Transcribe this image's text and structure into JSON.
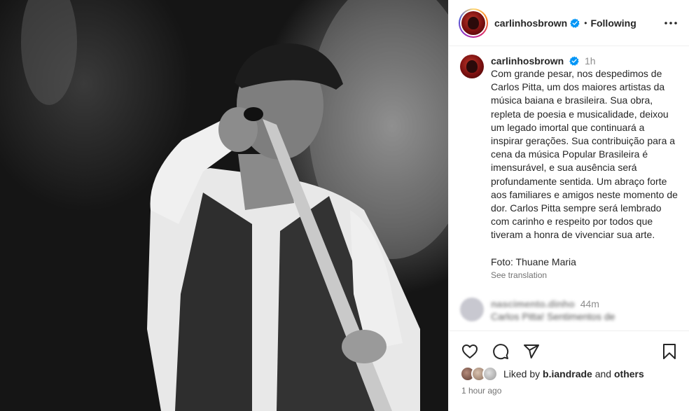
{
  "post": {
    "username": "carlinhosbrown",
    "follow_status": "Following",
    "separator": "•",
    "more_icon": "more-horizontal-icon"
  },
  "caption": {
    "username": "carlinhosbrown",
    "time": "1h",
    "text": "Com grande pesar, nos despedimos de Carlos Pitta, um dos maiores artistas da música baiana e brasileira. Sua obra, repleta de poesia e musicalidade, deixou um legado imortal que continuará a inspirar gerações. Sua contribuição para a cena da música Popular Brasileira é imensurável, e sua ausência será profundamente sentida. Um abraço forte aos familiares e amigos neste momento de dor. Carlos Pitta sempre será lembrado com carinho e respeito por todos que tiveram a honra de vivenciar sua arte.",
    "credit": "Foto: Thuane Maria",
    "see_translation": "See translation"
  },
  "comment": {
    "username": "nascimento.dinho",
    "time": "44m",
    "text": "Carlos Pitta! Sentimentos de"
  },
  "actions": {
    "icons": [
      "heart-icon",
      "comment-icon",
      "share-icon",
      "bookmark-icon"
    ]
  },
  "likes": {
    "prefix": "Liked by",
    "user": "b.iandrade",
    "conj": "and",
    "others": "others"
  },
  "timestamp": "1 hour ago",
  "colors": {
    "verified": "#0095f6",
    "text": "#262626",
    "muted": "#8e8e8e",
    "border": "#efefef"
  }
}
